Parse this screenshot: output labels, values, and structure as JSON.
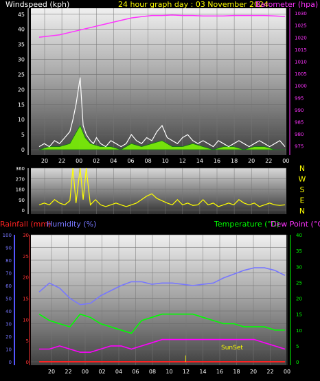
{
  "header": {
    "left_title": "Windspeed (kph)",
    "center_title": "24 hour graph day : 03 November 2024",
    "right_title": "Barometer (hpa)"
  },
  "bottom_header": {
    "rainfall": "Rainfall (mm)",
    "humidity": "Humidity (%)",
    "temperature": "Temperature (°C)",
    "dewpoint": "Dew Point (°C)"
  },
  "colors": {
    "windspeed": "#ffffff",
    "gust_fill": "#7cfc00",
    "barometer": "#ff33ff",
    "direction": "#ffff00",
    "humidity": "#7777ff",
    "temperature": "#00ff00",
    "dewpoint": "#ff00ff",
    "rainfall": "#ff2222",
    "axis_left": "#5555ff",
    "axis_rain": "#ff3333"
  },
  "chart_data": [
    {
      "type": "line",
      "name": "wind-barometer",
      "x_ticks": [
        "20",
        "22",
        "00",
        "02",
        "04",
        "06",
        "08",
        "10",
        "12",
        "14",
        "16",
        "18",
        "20",
        "22",
        "00"
      ],
      "y_left_ticks": [
        0,
        5,
        10,
        15,
        20,
        25,
        30,
        35,
        40,
        45
      ],
      "y_left_range": [
        0,
        47
      ],
      "y_right_ticks": [
        975,
        980,
        985,
        990,
        995,
        1000,
        1005,
        1010,
        1015,
        1020,
        1025,
        1030
      ],
      "y_right_range": [
        973.5,
        1032
      ],
      "series": [
        {
          "name": "Windspeed (kph)",
          "key": "windspeed",
          "x": [
            0,
            0.5,
            1,
            1.5,
            2,
            2.5,
            3,
            3.3,
            3.6,
            4,
            4.3,
            4.6,
            5,
            5.3,
            5.6,
            6,
            6.5,
            7,
            7.5,
            8,
            8.5,
            9,
            9.5,
            10,
            10.5,
            11,
            11.5,
            12,
            12.5,
            13,
            13.5,
            14,
            14.5,
            15,
            15.5,
            16,
            16.5,
            17,
            17.5,
            18,
            18.5,
            19,
            19.5,
            20,
            20.5,
            21,
            21.5,
            22,
            22.5,
            23,
            23.5,
            24
          ],
          "values": [
            1,
            2,
            1,
            3,
            2,
            4,
            6,
            10,
            15,
            24,
            8,
            5,
            3,
            2,
            4,
            2,
            1,
            3,
            2,
            1,
            2,
            5,
            3,
            2,
            4,
            3,
            6,
            8,
            4,
            3,
            2,
            4,
            5,
            3,
            2,
            3,
            2,
            1,
            3,
            2,
            1,
            2,
            3,
            2,
            1,
            2,
            3,
            2,
            1,
            2,
            3,
            1
          ]
        },
        {
          "name": "Wind gust",
          "key": "gust",
          "x": [
            0,
            1,
            2,
            3,
            3.5,
            4,
            4.5,
            5,
            6,
            7,
            8,
            9,
            10,
            11,
            12,
            13,
            14,
            15,
            16,
            17,
            18,
            19,
            20,
            21,
            22,
            23,
            24
          ],
          "values": [
            0,
            1,
            1,
            2,
            5,
            8,
            4,
            2,
            1,
            1,
            0,
            2,
            1,
            2,
            3,
            1,
            1,
            2,
            1,
            0,
            1,
            1,
            0,
            1,
            1,
            0,
            0
          ]
        },
        {
          "name": "Barometer (hpa)",
          "key": "barometer",
          "axis": "right",
          "x": [
            0,
            1,
            2,
            3,
            4,
            5,
            6,
            7,
            8,
            9,
            10,
            11,
            12,
            13,
            14,
            15,
            16,
            17,
            18,
            19,
            20,
            21,
            22,
            23,
            24
          ],
          "values": [
            1020,
            1020.5,
            1021,
            1022,
            1023,
            1024,
            1025,
            1026,
            1027,
            1028,
            1028.5,
            1029,
            1029,
            1029.2,
            1029,
            1029,
            1028.8,
            1028.8,
            1028.8,
            1029,
            1029,
            1029,
            1029,
            1028.8,
            1028.6
          ]
        }
      ]
    },
    {
      "type": "line",
      "name": "wind-direction",
      "y_ticks": [
        0,
        90,
        180,
        270,
        360
      ],
      "y_range": [
        0,
        360
      ],
      "compass_labels": [
        "N",
        "W",
        "S",
        "E",
        "N"
      ],
      "x": [
        0,
        0.5,
        1,
        1.5,
        2,
        2.5,
        3,
        3.3,
        3.6,
        4,
        4.3,
        4.6,
        5,
        5.5,
        6,
        6.5,
        7,
        7.5,
        8,
        8.5,
        9,
        9.5,
        10,
        10.5,
        11,
        11.5,
        12,
        12.5,
        13,
        13.5,
        14,
        14.5,
        15,
        15.5,
        16,
        16.5,
        17,
        17.5,
        18,
        18.5,
        19,
        19.5,
        20,
        20.5,
        21,
        21.5,
        22,
        22.5,
        23,
        23.5,
        24
      ],
      "values": [
        45,
        60,
        45,
        90,
        60,
        45,
        80,
        360,
        60,
        360,
        90,
        360,
        45,
        90,
        45,
        30,
        45,
        60,
        45,
        30,
        45,
        60,
        90,
        120,
        140,
        100,
        80,
        60,
        45,
        90,
        45,
        60,
        40,
        45,
        90,
        45,
        60,
        30,
        45,
        60,
        45,
        90,
        60,
        45,
        60,
        30,
        45,
        60,
        45,
        40,
        45
      ]
    },
    {
      "type": "line",
      "name": "temp-humidity-rain",
      "x_ticks": [
        "20",
        "22",
        "00",
        "02",
        "04",
        "06",
        "08",
        "10",
        "12",
        "14",
        "16",
        "18",
        "20",
        "22",
        "00"
      ],
      "y_humidity_ticks": [
        0,
        10,
        20,
        30,
        40,
        50,
        60,
        70,
        80,
        90,
        100
      ],
      "y_rain_ticks": [
        0,
        5,
        10,
        15,
        20,
        25,
        30
      ],
      "y_temp_ticks": [
        0,
        5,
        10,
        15,
        20,
        25,
        30,
        35,
        40
      ],
      "annotation": "SunSet",
      "series": [
        {
          "name": "Humidity (%)",
          "key": "humidity",
          "axis": "left",
          "x": [
            0,
            1,
            2,
            3,
            4,
            5,
            6,
            7,
            8,
            9,
            10,
            11,
            12,
            13,
            14,
            15,
            16,
            17,
            18,
            19,
            20,
            21,
            22,
            23,
            24
          ],
          "values": [
            55,
            62,
            58,
            50,
            45,
            46,
            52,
            56,
            60,
            63,
            63,
            61,
            62,
            62,
            61,
            60,
            61,
            62,
            66,
            69,
            72,
            74,
            74,
            72,
            68
          ]
        },
        {
          "name": "Temperature (°C)",
          "key": "temperature",
          "axis": "temp",
          "x": [
            0,
            1,
            2,
            3,
            4,
            5,
            6,
            7,
            8,
            9,
            10,
            11,
            12,
            13,
            14,
            15,
            16,
            17,
            18,
            19,
            20,
            21,
            22,
            23,
            24
          ],
          "values": [
            15,
            13,
            12,
            11,
            15,
            14,
            12,
            11,
            10,
            9,
            13,
            14,
            15,
            15,
            15,
            15,
            14,
            13,
            12,
            12,
            11,
            11,
            11,
            10,
            10
          ]
        },
        {
          "name": "Dew Point (°C)",
          "key": "dewpoint",
          "axis": "temp",
          "x": [
            0,
            1,
            2,
            3,
            4,
            5,
            6,
            7,
            8,
            9,
            10,
            11,
            12,
            13,
            14,
            15,
            16,
            17,
            18,
            19,
            20,
            21,
            22,
            23,
            24
          ],
          "values": [
            4,
            4,
            5,
            4,
            3,
            3,
            4,
            5,
            5,
            4,
            5,
            6,
            7,
            7,
            7,
            7,
            7,
            7,
            7,
            7,
            7,
            7,
            6,
            5,
            4
          ]
        },
        {
          "name": "Rainfall (mm)",
          "key": "rainfall",
          "axis": "rain",
          "x": [
            0,
            24
          ],
          "values": [
            0,
            0
          ]
        }
      ]
    }
  ]
}
